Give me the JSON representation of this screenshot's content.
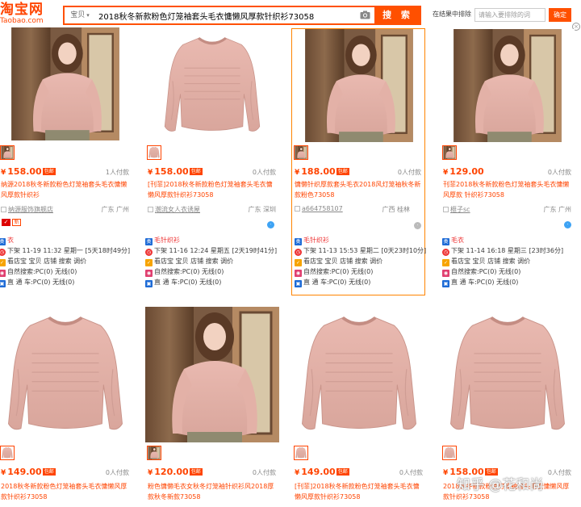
{
  "header": {
    "logo_text": "淘宝网",
    "logo_sub": "Taobao.com",
    "search_category": "宝贝",
    "search_query": "2018秋冬新款粉色灯笼袖套头毛衣慵懒风厚款针织衫73058",
    "search_button": "搜 索",
    "resort_label": "在结果中排除",
    "resort_placeholder": "请输入要排除的词",
    "resort_button": "确定"
  },
  "items": [
    {
      "price": "158.00",
      "paid": "1人付款",
      "title": "纳源2018秋冬新款粉色灯笼袖套头毛衣慵懒风厚款针织衫",
      "shop": "纳源服饰旗舰店",
      "location": "广东 广州",
      "ww": "active",
      "tag": "",
      "time": "",
      "view": "",
      "natural": "",
      "through": ""
    },
    {
      "price": "158.00",
      "paid": "0人付款",
      "title": "[刊菲]2018秋冬新款粉色灯笼袖套头毛衣慵懒风厚款针织衫73058",
      "shop": "潮流女人衣诱屋",
      "location": "广东 深圳",
      "ww": "active",
      "tag": "毛针织衫",
      "time": "下架 11-16 12:24 星期五 [2天19时41分]",
      "view": "看店宝 宝贝 店铺 搜索 调价",
      "natural": "自然搜索:PC(0) 无线(0)",
      "through": "直 通 车:PC(0) 无线(0)"
    },
    {
      "price": "188.00",
      "paid": "0人付款",
      "title": "慵懒针织厚款套头毛衣2018风灯笼袖秋冬新款粉色73058",
      "shop": "a664758107",
      "location": "广西 桂林",
      "ww": "offline",
      "tag": "毛针织衫",
      "time": "下架 11-13 15:53 星期二 [0天23时10分]",
      "view": "看店宝 宝贝 店铺 搜索 调价",
      "natural": "自然搜索:PC(0) 无线(0)",
      "through": "直 通 车:PC(0) 无线(0)"
    },
    {
      "price": "129.00",
      "paid": "0人付款",
      "title": "刊菲2018秋冬新款粉色灯笼袖套头毛衣慵懒风厚款 针织衫73058",
      "shop": "榧子sc",
      "location": "广东 广州",
      "ww": "active",
      "tag": "毛衣",
      "time": "下架 11-14 16:18 星期三 [23时36分]",
      "view": "看店宝 宝贝 店铺 搜索 调价",
      "natural": "自然搜索:PC(0) 无线(0)",
      "through": "直 通 车:PC(0) 无线(0)"
    },
    {
      "price": "149.00",
      "paid": "0人付款",
      "title": "2018秋冬新款粉色灯笼袖套头毛衣慵懒风厚款针织衫73058"
    },
    {
      "price": "120.00",
      "paid": "0人付款",
      "title": "粉色慵懒毛衣女秋冬灯笼袖针织衫风2018厚款秋冬新款73058"
    },
    {
      "price": "149.00",
      "paid": "0人付款",
      "title": "[刊菲]2018秋冬新款粉色灯笼袖套头毛衣慵懒风厚款针织衫73058"
    },
    {
      "price": "158.00",
      "paid": "0人付款",
      "title": "2018秋冬新款粉色灯笼袖套头毛衣慵懒风厚款针织衫73058"
    }
  ],
  "row1_extra": {
    "item1_tag": "衣",
    "item1_time": "下架 11-19 11:32 星期一 [5天18时49分]",
    "item1_view": "看店宝 宝贝 店铺 搜索 调价",
    "item1_natural": "自然搜索:PC(0) 无线(0)",
    "item1_through": "直 通 车:PC(0) 无线(0)",
    "new_badge": "新"
  },
  "watermark": "知乎 @花和尚",
  "colors": {
    "accent": "#ff4400",
    "search_border": "#ff5000",
    "link_blue": "#1e6bd6"
  }
}
